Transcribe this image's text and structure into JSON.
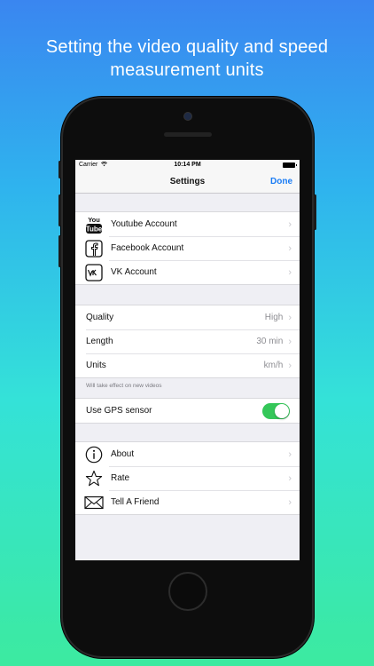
{
  "caption": {
    "line1": "Setting the video quality and speed",
    "line2": "measurement units"
  },
  "status_bar": {
    "carrier": "Carrier",
    "wifi_icon": "wifi-icon",
    "time": "10:14 PM",
    "battery_icon": "battery-icon"
  },
  "navbar": {
    "title": "Settings",
    "done_label": "Done"
  },
  "accounts": [
    {
      "label": "Youtube Account",
      "icon": "youtube-icon"
    },
    {
      "label": "Facebook Account",
      "icon": "facebook-icon"
    },
    {
      "label": "VK Account",
      "icon": "vk-icon"
    }
  ],
  "video_settings": [
    {
      "label": "Quality",
      "value": "High"
    },
    {
      "label": "Length",
      "value": "30 min"
    },
    {
      "label": "Units",
      "value": "km/h"
    }
  ],
  "video_settings_footnote": "Will take effect on new videos",
  "gps": {
    "label": "Use GPS sensor",
    "enabled": true,
    "color": "#34c759"
  },
  "info": [
    {
      "label": "About",
      "icon": "info-icon"
    },
    {
      "label": "Rate",
      "icon": "star-icon"
    },
    {
      "label": "Tell A Friend",
      "icon": "mail-icon"
    }
  ],
  "colors": {
    "accent": "#1a7cf5"
  }
}
